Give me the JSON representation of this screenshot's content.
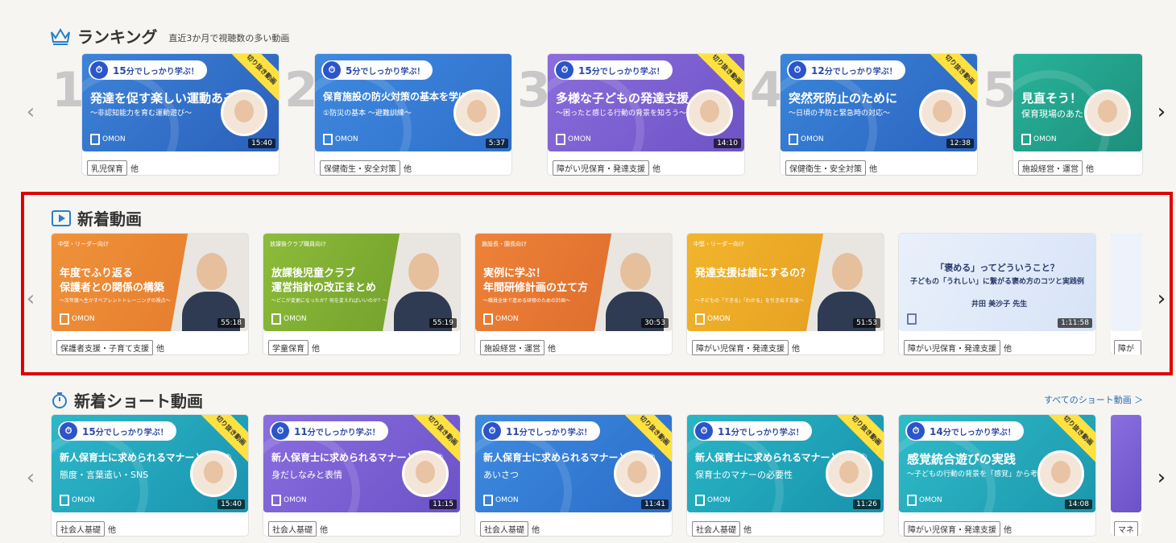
{
  "ranking": {
    "title": "ランキング",
    "subtitle": "直近3か月で視聴数の多い動画",
    "cards": [
      {
        "rank": "1",
        "badge_min": "15",
        "badge_text": "分でしっかり学ぶ！",
        "ribbon": "切り抜き動画",
        "title1": "発達を促す楽しい運動あそび①",
        "title2": "～非認知能力を育む運動遊び～",
        "duration": "15:40",
        "tag": "乳児保育",
        "etc": "他",
        "bg": "#3d84d9",
        "bg2": "#2a5fba"
      },
      {
        "rank": "2",
        "badge_min": "5",
        "badge_text": "分でしっかり学ぶ！",
        "ribbon": "",
        "title1": "保育施設の防火対策の基本を学ぼう",
        "title2": "①防災の基本 ～避難訓練～",
        "duration": "5:37",
        "tag": "保健衛生・安全対策",
        "etc": "他",
        "bg": "#3f8ae0",
        "bg2": "#2f6fca"
      },
      {
        "rank": "3",
        "badge_min": "15",
        "badge_text": "分でしっかり学ぶ！",
        "ribbon": "切り抜き動画",
        "title1": "多様な子どもの発達支援",
        "title2": "～困ったと感じる行動の背景を知ろう～",
        "duration": "14:10",
        "tag": "障がい児保育・発達支援",
        "etc": "他",
        "bg": "#8b6ddc",
        "bg2": "#6e53c5"
      },
      {
        "rank": "4",
        "badge_min": "12",
        "badge_text": "分でしっかり学ぶ！",
        "ribbon": "切り抜き動画",
        "title1": "突然死防止のために",
        "title2": "～日頃の予防と緊急時の対応～",
        "duration": "12:38",
        "tag": "保健衛生・安全対策",
        "etc": "他",
        "bg": "#3a86da",
        "bg2": "#2b63bf"
      },
      {
        "rank": "5",
        "badge_min": "",
        "badge_text": "",
        "ribbon": "",
        "title1": "見直そう！",
        "title2": "保育現場のあたりまえ",
        "duration": "",
        "tag": "施設経営・運営",
        "etc": "他",
        "bg": "#29b39a",
        "bg2": "#1d8f7c"
      }
    ]
  },
  "new_videos": {
    "title": "新着動画",
    "cards": [
      {
        "cat": "中堅・リーダー向け",
        "title1": "年度でふり返る",
        "title2": "保護者との関係の構築",
        "sub": "～次年度へ生かすペアレントトレーニングの視点～",
        "duration": "55:18",
        "tag": "保護者支援・子育て支援",
        "etc": "他",
        "bg": "#f0923a",
        "bg2": "#e2772a"
      },
      {
        "cat": "放課後クラブ職員向け",
        "title1": "放課後児童クラブ",
        "title2": "運営指針の改正まとめ",
        "sub": "～どこが変更になったか？何を変えればいいのか？～",
        "duration": "55:19",
        "tag": "学童保育",
        "etc": "他",
        "bg": "#8dbb3a",
        "bg2": "#6c9a28"
      },
      {
        "cat": "施設長・園長向け",
        "title1": "実例に学ぶ！",
        "title2": "年間研修計画の立て方",
        "sub": "～職員全体で進める研修のための計画～",
        "duration": "30:53",
        "tag": "施設経営・運営",
        "etc": "他",
        "bg": "#ee8238",
        "bg2": "#d9682a"
      },
      {
        "cat": "中堅・リーダー向け",
        "title1": "発達支援は誰にするの？",
        "title2": "",
        "sub": "～子どもの「できる」「わかる」を引き出す支援～",
        "duration": "51:53",
        "tag": "障がい児保育・発達支援",
        "etc": "他",
        "bg": "#f2b52c",
        "bg2": "#e39a1f"
      },
      {
        "cat": "",
        "title1": "「褒める」ってどういうこと？",
        "title2": "子どもの「うれしい」に繋がる褒め方のコツと実践例",
        "sub": "井田 美沙子 先生",
        "duration": "1:11:58",
        "tag": "障がい児保育・発達支援",
        "etc": "他",
        "bg": "#e9f0fb",
        "bg2": "#d7e3f6"
      }
    ],
    "partial_tag": "障がい"
  },
  "short_videos": {
    "title": "新着ショート動画",
    "see_all": "すべてのショート動画 ＞",
    "cards": [
      {
        "badge_min": "15",
        "badge_text": "分でしっかり学ぶ！",
        "ribbon": "切り抜き動画",
        "title1": "新人保育士に求められるマナーとは？④",
        "title2": "態度・言葉遣い・SNS",
        "duration": "15:40",
        "tag": "社会人基礎",
        "etc": "他",
        "bg": "#2db8c8",
        "bg2": "#1a93b0"
      },
      {
        "badge_min": "11",
        "badge_text": "分でしっかり学ぶ！",
        "ribbon": "切り抜き動画",
        "title1": "新人保育士に求められるマナーとは？③",
        "title2": "身だしなみと表情",
        "duration": "11:15",
        "tag": "社会人基礎",
        "etc": "他",
        "bg": "#8a6ee0",
        "bg2": "#6b52c7"
      },
      {
        "badge_min": "11",
        "badge_text": "分でしっかり学ぶ！",
        "ribbon": "切り抜き動画",
        "title1": "新人保育士に求められるマナーとは？②",
        "title2": "あいさつ",
        "duration": "11:41",
        "tag": "社会人基礎",
        "etc": "他",
        "bg": "#3e8ce0",
        "bg2": "#2b6cc8"
      },
      {
        "badge_min": "11",
        "badge_text": "分でしっかり学ぶ！",
        "ribbon": "切り抜き動画",
        "title1": "新人保育士に求められるマナーとは？①",
        "title2": "保育士のマナーの必要性",
        "duration": "11:26",
        "tag": "社会人基礎",
        "etc": "他",
        "bg": "#28b6c6",
        "bg2": "#1892ac"
      },
      {
        "badge_min": "14",
        "badge_text": "分でしっかり学ぶ！",
        "ribbon": "切り抜き動画",
        "title1": "感覚統合遊びの実践",
        "title2": "～子どもの行動の背景を「感覚」から考えよう～",
        "duration": "14:08",
        "tag": "障がい児保育・発達支援",
        "etc": "他",
        "bg": "#2fbcc9",
        "bg2": "#1c97ad"
      }
    ],
    "partial_tag": "マネ"
  },
  "logo_text": "OMON",
  "nav": {
    "prev": "‹",
    "next": "›"
  }
}
